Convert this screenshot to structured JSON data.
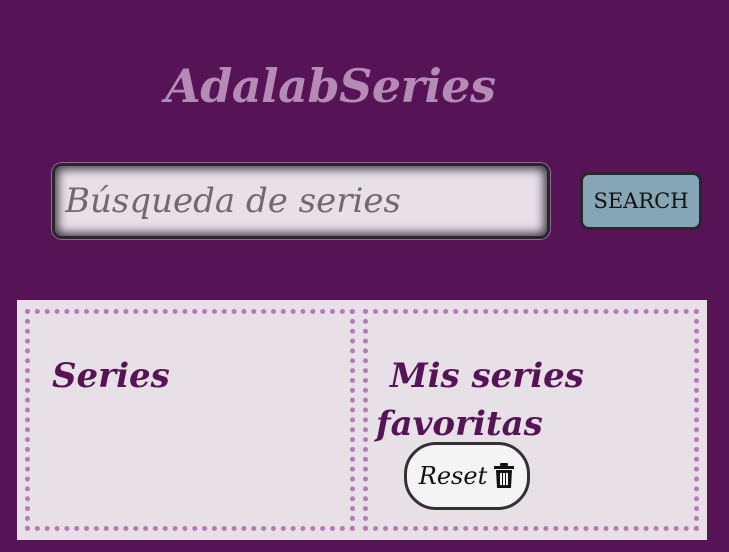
{
  "header": {
    "title": "AdalabSeries"
  },
  "search": {
    "placeholder": "Búsqueda de series",
    "value": "",
    "button_label": "SEARCH"
  },
  "panels": {
    "series_title": "Series",
    "favorites_title": "Mis series favoritas",
    "reset_label": "Reset",
    "reset_icon": "trash-icon"
  },
  "colors": {
    "background": "#561456",
    "title": "#b58ab7",
    "panel": "#e7e0e7",
    "search_button": "#86a5b5",
    "dotted_border": "#b879b8"
  }
}
